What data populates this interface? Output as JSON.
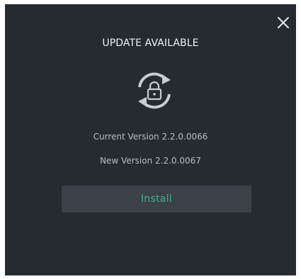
{
  "dialog": {
    "title": "UPDATE AVAILABLE",
    "icon": "sync-lock-icon",
    "current_version": "Current Version 2.2.0.0066",
    "new_version": "New Version 2.2.0.0067",
    "install_label": "Install",
    "close_icon": "close-icon"
  },
  "colors": {
    "background": "#262a31",
    "title": "#f1f2f4",
    "text": "#b9bdc5",
    "button_bg": "#3b4049",
    "button_text": "#3fb68a"
  }
}
